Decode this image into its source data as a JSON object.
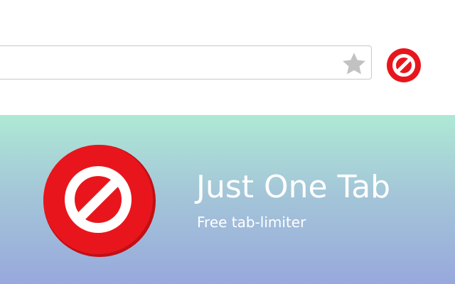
{
  "promo": {
    "title": "Just One Tab",
    "subtitle": "Free tab-limiter"
  },
  "icons": {
    "bookmark": "star-icon",
    "extension": "no-entry-icon",
    "logo": "no-entry-icon"
  },
  "colors": {
    "brand_red": "#e8161c",
    "icon_white": "#ffffff",
    "star_gray": "#c2c2c2",
    "gradient_top": "#aee9d5",
    "gradient_bottom": "#98a8dc"
  }
}
